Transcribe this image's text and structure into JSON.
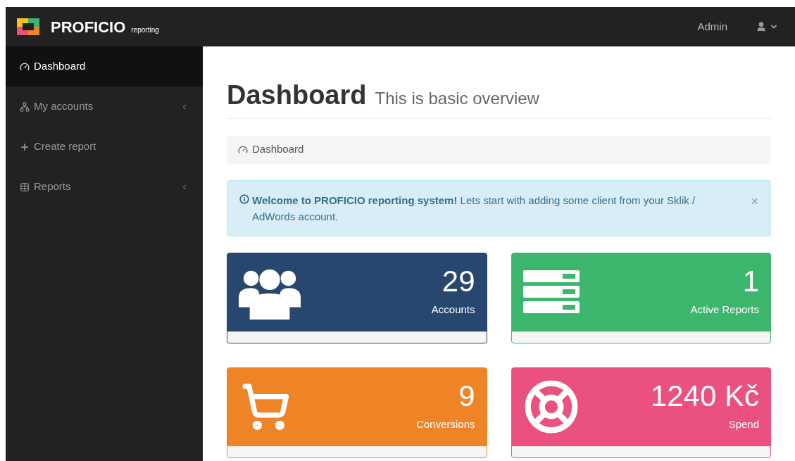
{
  "navbar": {
    "brand": "PROFICIO",
    "brand_sub": "reporting",
    "user": "Admin"
  },
  "sidebar": {
    "items": [
      {
        "label": "Dashboard",
        "kind": "gauge",
        "selected": true,
        "has_submenu": false
      },
      {
        "label": "My accounts",
        "kind": "sitemap",
        "selected": false,
        "has_submenu": true
      },
      {
        "label": "Create report",
        "kind": "plus",
        "selected": false,
        "has_submenu": false
      },
      {
        "label": "Reports",
        "kind": "table",
        "selected": false,
        "has_submenu": true
      }
    ]
  },
  "header": {
    "title": "Dashboard",
    "subtitle": "This is basic overview"
  },
  "breadcrumb": {
    "label": "Dashboard"
  },
  "alert": {
    "text": "**Welcome to PROFICIO reporting system!** Lets start with adding some client from your Sklik / AdWords account.",
    "close": "×"
  },
  "stats": [
    {
      "kind": "users",
      "value": "29",
      "label": "Accounts",
      "color": "#27476e"
    },
    {
      "kind": "list",
      "value": "1",
      "label": "Active Reports",
      "color": "#3cb66c"
    },
    {
      "kind": "cart",
      "value": "9",
      "label": "Conversions",
      "color": "#ef8427"
    },
    {
      "kind": "lifebuoy",
      "value": "1240 Kč",
      "label": "Spend",
      "color": "#ea517e"
    }
  ]
}
